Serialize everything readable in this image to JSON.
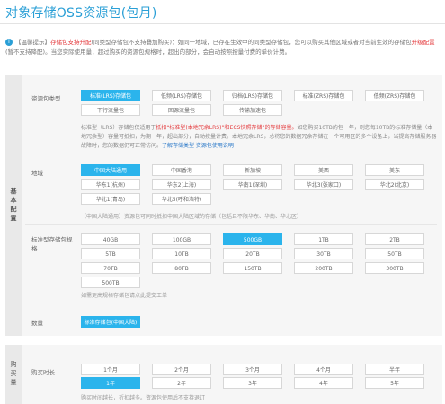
{
  "page": {
    "title": "对象存储OSS资源包(包月)"
  },
  "notice": {
    "icon": "info-icon",
    "prefix": "【温馨提示】",
    "red1": "存储包支持升配",
    "text1": "(同类型存储包不支持叠加购买)：如同一地域，已存在生效中的同类型存储包，您可以购买其他区域或者对当前生效的存储包",
    "red2": "升级配置",
    "text2": "(暂不支持降配)。当您实际使用量，超过购买的资源包规格时，超出的部分，会自动按照按量付费的单价计费。"
  },
  "basic_tab": "基本配置",
  "buy_tab": "购买量",
  "storage_type": {
    "label": "资源包类型",
    "options": [
      "标准(LRS)存储包",
      "低频(LRS)存储包",
      "归档(LRS)存储包",
      "标准(ZRS)存储包",
      "低频(ZRS)存储包",
      "下行流量包",
      "回源流量包",
      "传输加速包"
    ],
    "selected_index": 0,
    "desc_prefix": "标准型（LRS）存储包仅适用于",
    "desc_red": "抵扣“标准型(本地冗余LRS)”和ECS快照存储”的存储容量。",
    "desc_mid": "如您购买10TB的包一年，则您每10TB的标准存储量（本地冗余型）容量可抵扣，为期一年，超出部分，自动按量计费。本地冗余LRS，总将您的数据冗余存储在一个可用区的多个设备上，当提高存储服务器故障时，您的数据仍可正常访问。",
    "desc_link": "了解存储类型 资源包使用说明"
  },
  "region": {
    "label": "地域",
    "options": [
      "中国大陆通用",
      "中国香港",
      "新加坡",
      "美西",
      "美东",
      "华东1(杭州)",
      "华东2(上海)",
      "华南1(深圳)",
      "华北3(张家口)",
      "华北2(北京)",
      "华北1(青岛)",
      "华北5(呼和浩特)"
    ],
    "selected_index": 0,
    "hint": "【中国大陆通用】资源包可同时抵扣中国大陆区域的存储（包括且不限华东、华南、华北区）"
  },
  "capacity": {
    "label": "标准型存储包规格",
    "options": [
      "40GB",
      "100GB",
      "500GB",
      "1TB",
      "2TB",
      "5TB",
      "10TB",
      "20TB",
      "30TB",
      "50TB",
      "70TB",
      "80TB",
      "150TB",
      "200TB",
      "300TB",
      "500TB"
    ],
    "selected_index": 2,
    "hint": "如需更高规格存储包请点此提交工单"
  },
  "quantity": {
    "label": "数量",
    "value": "标准存储包(中国大陆)"
  },
  "duration": {
    "label": "购买时长",
    "options": [
      "1个月",
      "2个月",
      "3个月",
      "4个月",
      "半年",
      "1年",
      "2年",
      "3年",
      "4年",
      "5年"
    ],
    "selected_index": 5,
    "hint": "购买时间越长，折扣越多。资源包使用后不支持退订"
  }
}
